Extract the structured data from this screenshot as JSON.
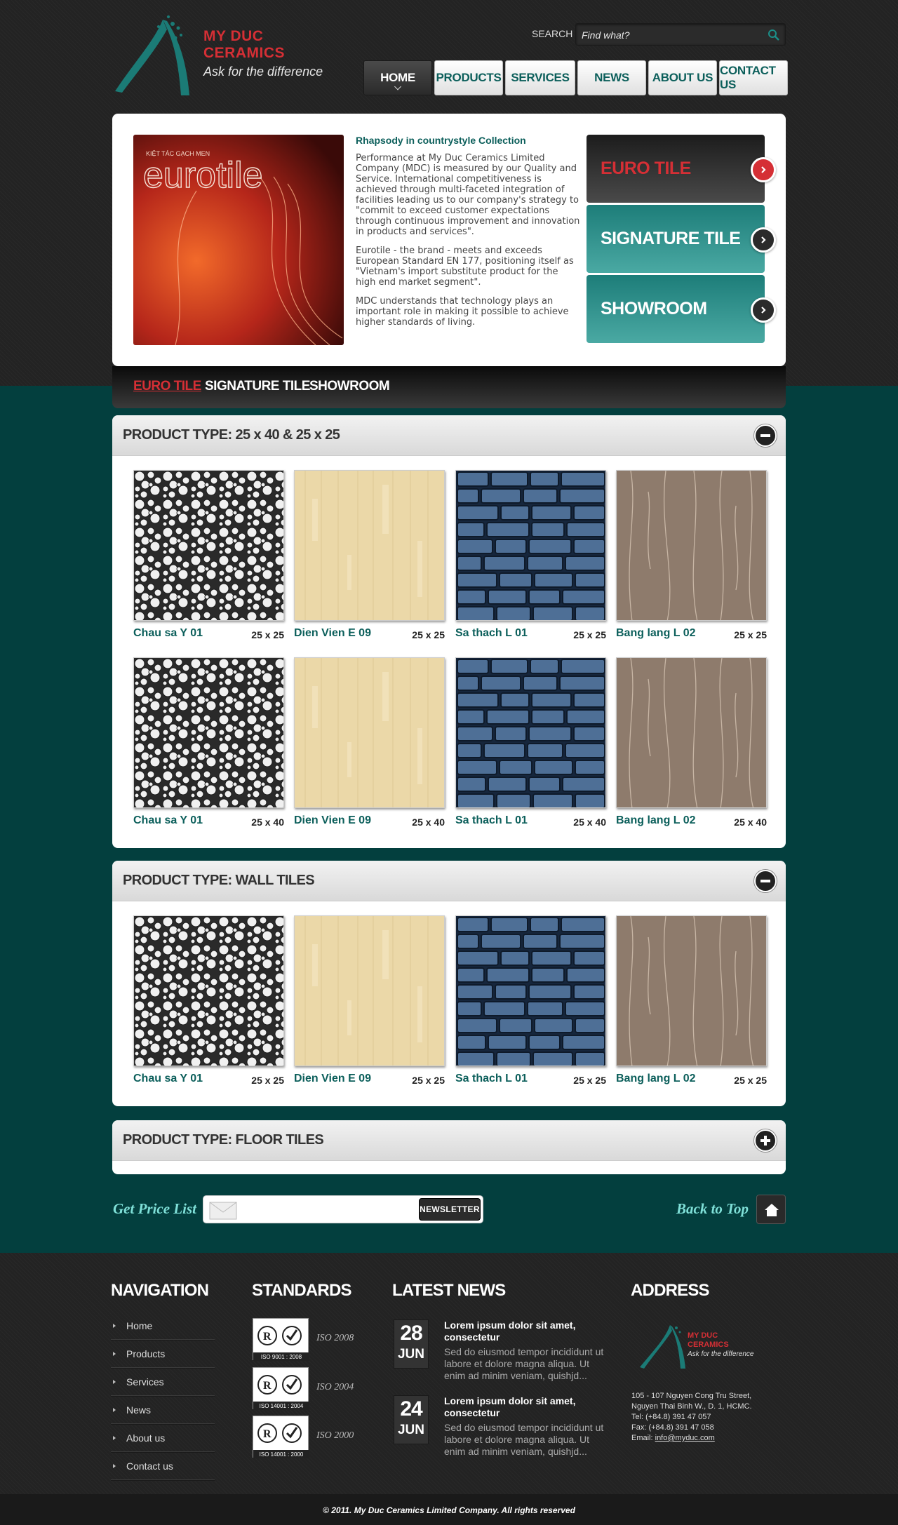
{
  "brand": {
    "name_line1": "MY DUC",
    "name_line2": "CERAMICS",
    "tagline": "Ask for the difference",
    "logo_primary": "#1b7b76",
    "logo_accent": "#d52f35"
  },
  "search": {
    "label": "SEARCH",
    "placeholder": "Find what?",
    "icon": "search-icon"
  },
  "nav": {
    "items": [
      {
        "label": "HOME",
        "active": true
      },
      {
        "label": "PRODUCTS",
        "active": false
      },
      {
        "label": "SERVICES",
        "active": false
      },
      {
        "label": "NEWS",
        "active": false
      },
      {
        "label": "ABOUT US",
        "active": false
      },
      {
        "label": "CONTACT US",
        "active": false
      }
    ]
  },
  "hero": {
    "image_caption_small": "KIỆT TÁC GẠCH MEN",
    "image_caption_big": "eurotile",
    "title": "Rhapsody in countrystyle Collection",
    "paragraphs": [
      "Performance at My Duc Ceramics Limited Company (MDC) is measured by our Quality and Service. International competitiveness is achieved through multi-faceted integration of facilities leading us to our company's strategy to \"commit to exceed customer expectations through continuous improvement and innovation in products and services\".",
      "Eurotile - the brand - meets and exceeds European Standard EN 177, positioning itself as \"Vietnam's import substitute product for the high end market segment\".",
      "MDC understands that technology plays an important role in making it possible to achieve higher standards of living."
    ],
    "tabs": [
      {
        "label": "EURO TILE",
        "style": "dark"
      },
      {
        "label": "SIGNATURE TILE",
        "style": "teal"
      },
      {
        "label": "SHOWROOM",
        "style": "teal"
      }
    ]
  },
  "subnav": {
    "items": [
      {
        "label": "EURO TILE",
        "active": true
      },
      {
        "label": "SIGNATURE TILE",
        "active": false
      },
      {
        "label": "SHOWROOM",
        "active": false
      }
    ]
  },
  "panels": [
    {
      "title": "PRODUCT TYPE: 25 x 40 & 25 x 25",
      "state": "expanded",
      "rows": [
        [
          {
            "name": "Chau sa Y 01",
            "size": "25 x 25",
            "pattern": "circles"
          },
          {
            "name": "Dien Vien E 09",
            "size": "25 x 25",
            "pattern": "wood"
          },
          {
            "name": "Sa thach L 01",
            "size": "25 x 25",
            "pattern": "stone"
          },
          {
            "name": "Bang lang L 02",
            "size": "25 x 25",
            "pattern": "vines"
          }
        ],
        [
          {
            "name": "Chau sa Y 01",
            "size": "25 x 40",
            "pattern": "circles"
          },
          {
            "name": "Dien Vien E 09",
            "size": "25 x 40",
            "pattern": "wood"
          },
          {
            "name": "Sa thach L 01",
            "size": "25 x 40",
            "pattern": "stone"
          },
          {
            "name": "Bang lang L 02",
            "size": "25 x 40",
            "pattern": "vines"
          }
        ]
      ]
    },
    {
      "title": "PRODUCT TYPE: WALL TILES",
      "state": "expanded",
      "rows": [
        [
          {
            "name": "Chau sa Y 01",
            "size": "25 x 25",
            "pattern": "circles"
          },
          {
            "name": "Dien Vien E 09",
            "size": "25 x 25",
            "pattern": "wood"
          },
          {
            "name": "Sa thach L 01",
            "size": "25 x 25",
            "pattern": "stone"
          },
          {
            "name": "Bang lang L 02",
            "size": "25 x 25",
            "pattern": "vines"
          }
        ]
      ]
    },
    {
      "title": "PRODUCT TYPE: FLOOR TILES",
      "state": "collapsed",
      "rows": []
    }
  ],
  "pricelist": {
    "label": "Get Price List",
    "button": "NEWSLETTER",
    "back_to_top": "Back to Top"
  },
  "footer": {
    "navigation": {
      "title": "NAVIGATION",
      "items": [
        "Home",
        "Products",
        "Services",
        "News",
        "About us",
        "Contact us"
      ]
    },
    "standards": {
      "title": "STANDARDS",
      "items": [
        {
          "badge": "ISO 9001 : 2008",
          "label": "ISO 2008"
        },
        {
          "badge": "ISO 14001 : 2004",
          "label": "ISO 2004"
        },
        {
          "badge": "ISO 14001 : 2000",
          "label": "ISO 2000"
        }
      ]
    },
    "news": {
      "title": "LATEST NEWS",
      "items": [
        {
          "day": "28",
          "month": "JUN",
          "title": "Lorem ipsum dolor sit amet, consectetur",
          "body": "Sed do eiusmod tempor incididunt ut labore et dolore magna aliqua. Ut enim ad minim veniam, quishjd..."
        },
        {
          "day": "24",
          "month": "JUN",
          "title": "Lorem ipsum dolor sit amet, consectetur",
          "body": "Sed do eiusmod tempor incididunt ut labore et dolore magna aliqua. Ut enim ad minim veniam, quishjd..."
        }
      ]
    },
    "address": {
      "title": "ADDRESS",
      "line1": "105 - 107 Nguyen Cong Tru Street,",
      "line2": "Nguyen Thai Binh W., D. 1, HCMC.",
      "tel": "Tel: (+84.8) 391 47 057",
      "fax": "Fax: (+84.8) 391 47 058",
      "email_label": "Email: ",
      "email": "info@myduc.com"
    },
    "copyright": "© 2011. My Duc Ceramics Limited Company. All rights reserved"
  }
}
